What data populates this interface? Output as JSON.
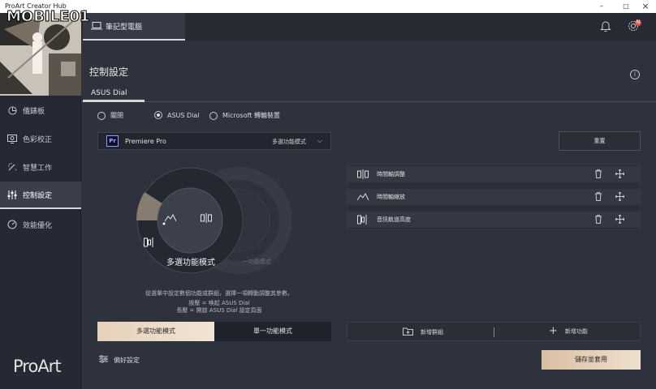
{
  "window": {
    "title": "ProArt Creator Hub",
    "controls": [
      "–",
      "□",
      "×"
    ]
  },
  "watermark": "MOBILE01",
  "sidebar": {
    "brand": "ProArt",
    "items": [
      {
        "label": "儀錶板",
        "icon": "pie-chart-icon"
      },
      {
        "label": "色彩校正",
        "icon": "monitor-color-icon"
      },
      {
        "label": "智慧工作",
        "icon": "magic-wand-icon"
      },
      {
        "label": "控制設定",
        "icon": "sliders-icon",
        "active": true
      },
      {
        "label": "效能優化",
        "icon": "speedometer-icon"
      }
    ]
  },
  "header": {
    "device_tab": "筆記型電腦",
    "notification_badge": "N"
  },
  "main": {
    "title": "控制設定",
    "subtab": "ASUS Dial",
    "radios": [
      {
        "label": "關閉",
        "checked": false
      },
      {
        "label": "ASUS Dial",
        "checked": true
      },
      {
        "label": "Microsoft 轉輪裝置",
        "checked": false
      }
    ],
    "app_select": {
      "badge": "Pr",
      "app": "Premiere Pro",
      "mode": "多選功能模式"
    },
    "reset_label": "重置",
    "dial": {
      "center_label": "多選功能模式",
      "ghost_label": "一功能模式"
    },
    "hint_lines": [
      "從選單中設定數個功能或群組，選擇一項轉動調整其參數。",
      "按壓 = 喚起 ASUS Dial",
      "長壓 = 開啟 ASUS Dial 設定頁面"
    ],
    "mode_tabs": {
      "multi": "多選功能模式",
      "single": "單一功能模式"
    },
    "functions": [
      {
        "label": "時間軸調整",
        "icon": "timeline-adjust-icon"
      },
      {
        "label": "時間軸縮放",
        "icon": "timeline-zoom-icon"
      },
      {
        "label": "音訊軌道高度",
        "icon": "audio-track-icon"
      }
    ],
    "add_group_label": "新增群組",
    "add_function_label": "新增功能",
    "prefs_label": "偏好設定",
    "save_label": "儲存並套用"
  },
  "colors": {
    "accent": "#e6d1bb",
    "bg": "#2d323d",
    "sidebar": "#252933"
  }
}
